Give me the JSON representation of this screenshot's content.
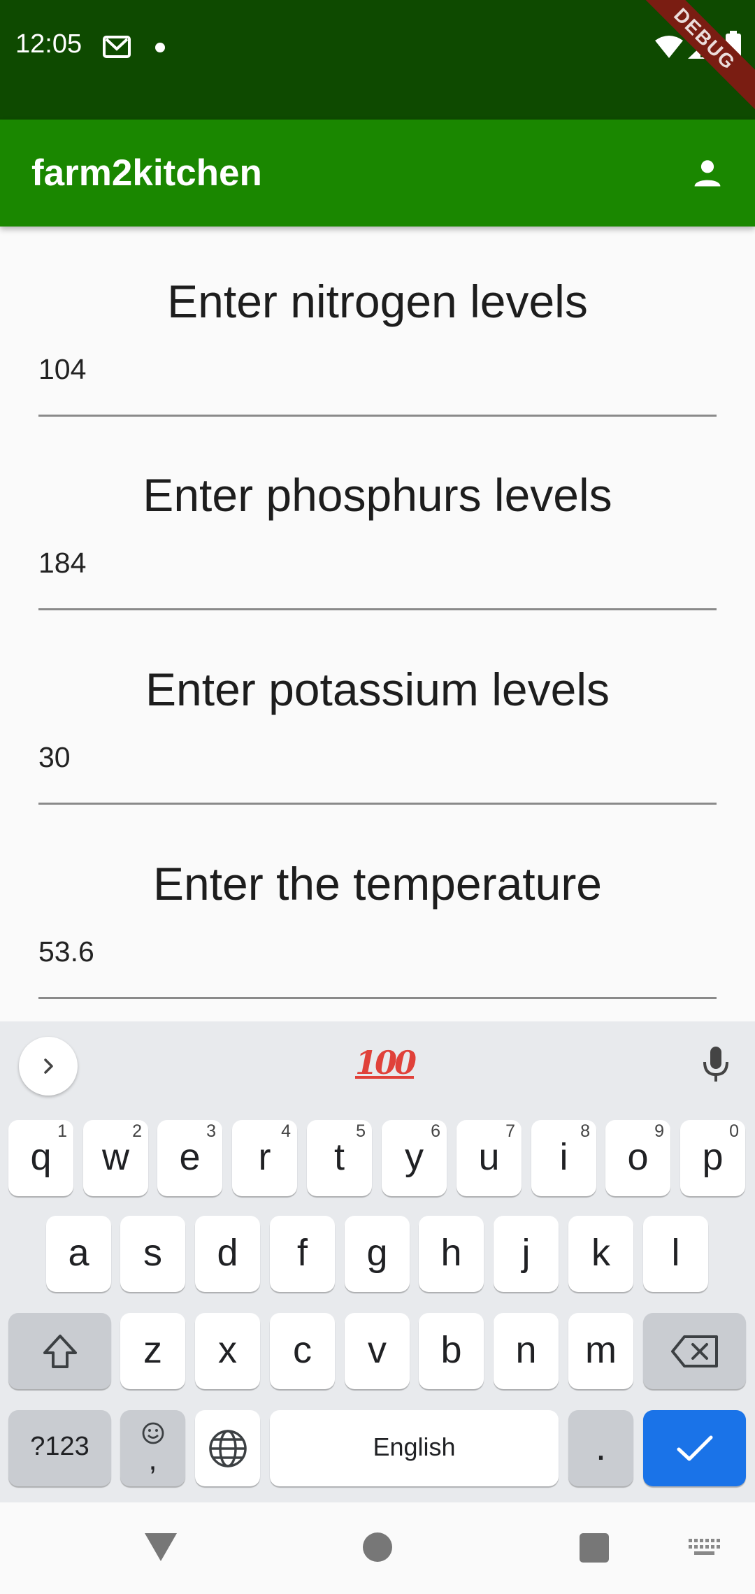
{
  "status_bar": {
    "time": "12:05",
    "debug_label": "DEBUG",
    "icons": [
      "gmail-icon",
      "notification-dot-icon",
      "wifi-icon",
      "signal-icon",
      "battery-icon"
    ]
  },
  "app_bar": {
    "title": "farm2kitchen",
    "color": "#1a8700",
    "status_color": "#0e4a00",
    "action_icon": "account-icon"
  },
  "form": {
    "fields": [
      {
        "label": "Enter nitrogen levels",
        "value": "104"
      },
      {
        "label": "Enter phosphurs levels",
        "value": "184"
      },
      {
        "label": "Enter potassium levels",
        "value": "30"
      },
      {
        "label": "Enter the temperature",
        "value": "53.6"
      }
    ]
  },
  "keyboard": {
    "suggestion_emoji": "100",
    "row1": [
      {
        "key": "q",
        "hint": "1"
      },
      {
        "key": "w",
        "hint": "2"
      },
      {
        "key": "e",
        "hint": "3"
      },
      {
        "key": "r",
        "hint": "4"
      },
      {
        "key": "t",
        "hint": "5"
      },
      {
        "key": "y",
        "hint": "6"
      },
      {
        "key": "u",
        "hint": "7"
      },
      {
        "key": "i",
        "hint": "8"
      },
      {
        "key": "o",
        "hint": "9"
      },
      {
        "key": "p",
        "hint": "0"
      }
    ],
    "row2": [
      "a",
      "s",
      "d",
      "f",
      "g",
      "h",
      "j",
      "k",
      "l"
    ],
    "row3": [
      "z",
      "x",
      "c",
      "v",
      "b",
      "n",
      "m"
    ],
    "symbols_label": "?123",
    "comma_label": ",",
    "space_label": "English",
    "period_label": ".",
    "done_color": "#1a73e8"
  }
}
